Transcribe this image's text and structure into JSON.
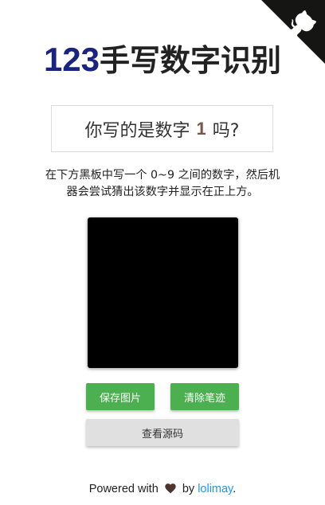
{
  "header": {
    "title_number": "123",
    "title_text": "手写数字识别"
  },
  "prediction": {
    "prefix": "你写的是数字",
    "digit": "1",
    "suffix": "吗?"
  },
  "instructions": "在下方黑板中写一个 0~9 之间的数字，然后机器会尝试猜出该数字并显示在正上方。",
  "buttons": {
    "save": "保存图片",
    "clear": "清除笔迹",
    "source": "查看源码"
  },
  "footer": {
    "powered": "Powered with",
    "by": "by",
    "author": "lolimay",
    "period": "."
  },
  "icons": {
    "github_corner": "github-octocat-icon",
    "heart": "heart-icon"
  },
  "colors": {
    "title_number": "#1a237e",
    "prediction_digit": "#795548",
    "button_green": "#4caf50",
    "button_grey": "#e0e0e0",
    "link": "#2196f3",
    "board": "#000000"
  }
}
